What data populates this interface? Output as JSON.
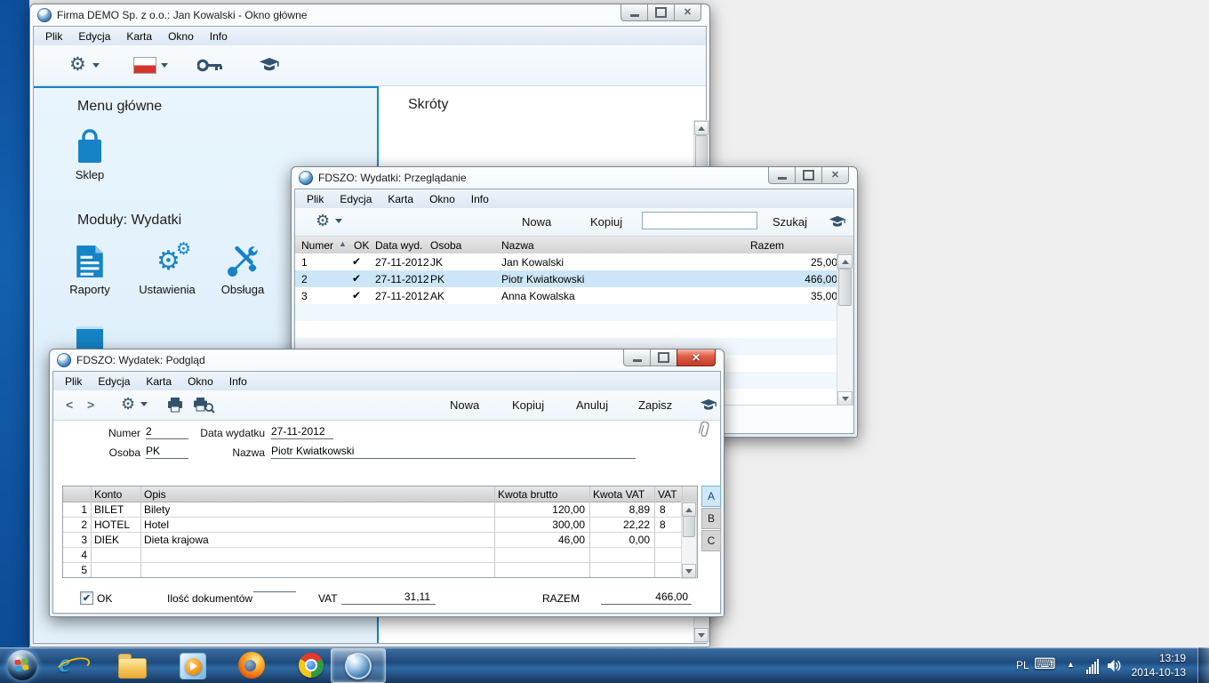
{
  "icons": {
    "gear": "⚙",
    "check": "✔",
    "sort_asc": "▲",
    "close": "✕",
    "keyboard": "⌨",
    "ie": "e",
    "prev": "<",
    "next": ">",
    "tray_expand": "▲"
  },
  "main_window": {
    "title": "Firma DEMO Sp. z o.o.: Jan Kowalski - Okno główne",
    "menu": [
      "Plik",
      "Edycja",
      "Karta",
      "Okno",
      "Info"
    ],
    "left_panel": {
      "heading": "Menu główne",
      "shop_label": "Sklep",
      "modules_heading": "Moduły: Wydatki",
      "module_labels": [
        "Raporty",
        "Ustawienia",
        "Obsługa"
      ]
    },
    "right_panel": {
      "heading": "Skróty"
    }
  },
  "browse_window": {
    "title": "FDSZO: Wydatki: Przeglądanie",
    "menu": [
      "Plik",
      "Edycja",
      "Karta",
      "Okno",
      "Info"
    ],
    "toolbar": {
      "new_label": "Nowa",
      "copy_label": "Kopiuj",
      "search_value": "",
      "search_label": "Szukaj"
    },
    "table": {
      "headers": {
        "numer": "Numer",
        "ok": "OK",
        "data": "Data wyd.",
        "osoba": "Osoba",
        "nazwa": "Nazwa",
        "razem": "Razem"
      },
      "rows": [
        {
          "numer": "1",
          "data": "27-11-2012",
          "osoba": "JK",
          "nazwa": "Jan Kowalski",
          "razem": "25,00"
        },
        {
          "numer": "2",
          "data": "27-11-2012",
          "osoba": "PK",
          "nazwa": "Piotr Kwiatkowski",
          "razem": "466,00"
        },
        {
          "numer": "3",
          "data": "27-11-2012",
          "osoba": "AK",
          "nazwa": "Anna Kowalska",
          "razem": "35,00"
        }
      ]
    }
  },
  "detail_window": {
    "title": "FDSZO: Wydatek: Podgląd",
    "menu": [
      "Plik",
      "Edycja",
      "Karta",
      "Okno",
      "Info"
    ],
    "toolbar": {
      "new_label": "Nowa",
      "copy_label": "Kopiuj",
      "cancel_label": "Anuluj",
      "save_label": "Zapisz"
    },
    "fields": {
      "numer_label": "Numer",
      "numer_value": "2",
      "data_label": "Data wydatku",
      "data_value": "27-11-2012",
      "osoba_label": "Osoba",
      "osoba_value": "PK",
      "nazwa_label": "Nazwa",
      "nazwa_value": "Piotr Kwiatkowski"
    },
    "grid": {
      "headers": {
        "konto": "Konto",
        "opis": "Opis",
        "brutto": "Kwota brutto",
        "kvat": "Kwota VAT",
        "vat": "VAT"
      },
      "rows": [
        {
          "num": "1",
          "konto": "BILET",
          "opis": "Bilety",
          "brutto": "120,00",
          "kvat": "8,89",
          "vat": "8"
        },
        {
          "num": "2",
          "konto": "HOTEL",
          "opis": "Hotel",
          "brutto": "300,00",
          "kvat": "22,22",
          "vat": "8"
        },
        {
          "num": "3",
          "konto": "DIEK",
          "opis": "Dieta krajowa",
          "brutto": "46,00",
          "kvat": "0,00",
          "vat": ""
        },
        {
          "num": "4",
          "konto": "",
          "opis": "",
          "brutto": "",
          "kvat": "",
          "vat": ""
        },
        {
          "num": "5",
          "konto": "",
          "opis": "",
          "brutto": "",
          "kvat": "",
          "vat": ""
        }
      ],
      "tabs": [
        "A",
        "B",
        "C"
      ]
    },
    "footer": {
      "ok_label": "OK",
      "docs_label": "Ilość dokumentów",
      "docs_value": "",
      "vat_label": "VAT",
      "vat_value": "31,11",
      "razem_label": "RAZEM",
      "razem_value": "466,00"
    }
  },
  "taskbar": {
    "tray": {
      "lang": "PL",
      "time": "13:19",
      "date": "2014-10-13"
    }
  },
  "colors": {
    "accent_blue": "#1583c6",
    "desktop_strip": "#0f58a8",
    "selection": "#cde6f7"
  }
}
